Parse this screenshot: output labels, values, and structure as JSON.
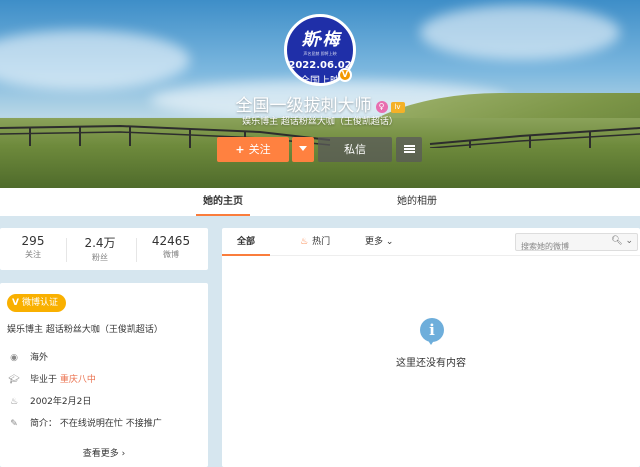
{
  "profile": {
    "avatar_logo": "斯·梅",
    "avatar_small": "声名显赫 即将上映",
    "avatar_date": "2022.06.02",
    "avatar_release": "全国上映",
    "verified_badge": "V",
    "name": "全国一级拔刺大师",
    "badge_member": "♀",
    "badge_level": "lv",
    "description": "娱乐博主 超话粉丝大咖（王俊凯超话）"
  },
  "actions": {
    "follow_plus": "+",
    "follow_label": "关注",
    "message_label": "私信"
  },
  "tabs": {
    "home": "她的主页",
    "album": "她的相册"
  },
  "stats": [
    {
      "value": "295",
      "label": "关注"
    },
    {
      "value": "2.4万",
      "label": "粉丝"
    },
    {
      "value": "42465",
      "label": "微博"
    }
  ],
  "info": {
    "verify_v": "V",
    "verify_label": "微博认证",
    "verify_desc": "娱乐博主 超话粉丝大咖（王俊凯超话）",
    "location": "海外",
    "edu_prefix": "毕业于",
    "school": "重庆八中",
    "birthday": "2002年2月2日",
    "bio_label": "简介：",
    "bio": "不在线说明在忙 不接推广",
    "more": "查看更多 ›"
  },
  "feed": {
    "tab_all": "全部",
    "tab_hot": "热门",
    "tab_more": "更多 ⌄",
    "search_placeholder": "搜索她的微博",
    "search_icon_glyph": "🔍︎ ⌄",
    "empty_text": "这里还没有内容",
    "empty_icon_glyph": "i"
  },
  "icons": {
    "location": "◉",
    "edu": "🎓︎",
    "birthday": "♨",
    "bio": "✎",
    "fire": "♨"
  },
  "colors": {
    "accent": "#ff8140",
    "link": "#eb7350",
    "verify": "#f9b000",
    "info_icon": "#6eaedb",
    "page_bg": "#d6e6ef"
  }
}
